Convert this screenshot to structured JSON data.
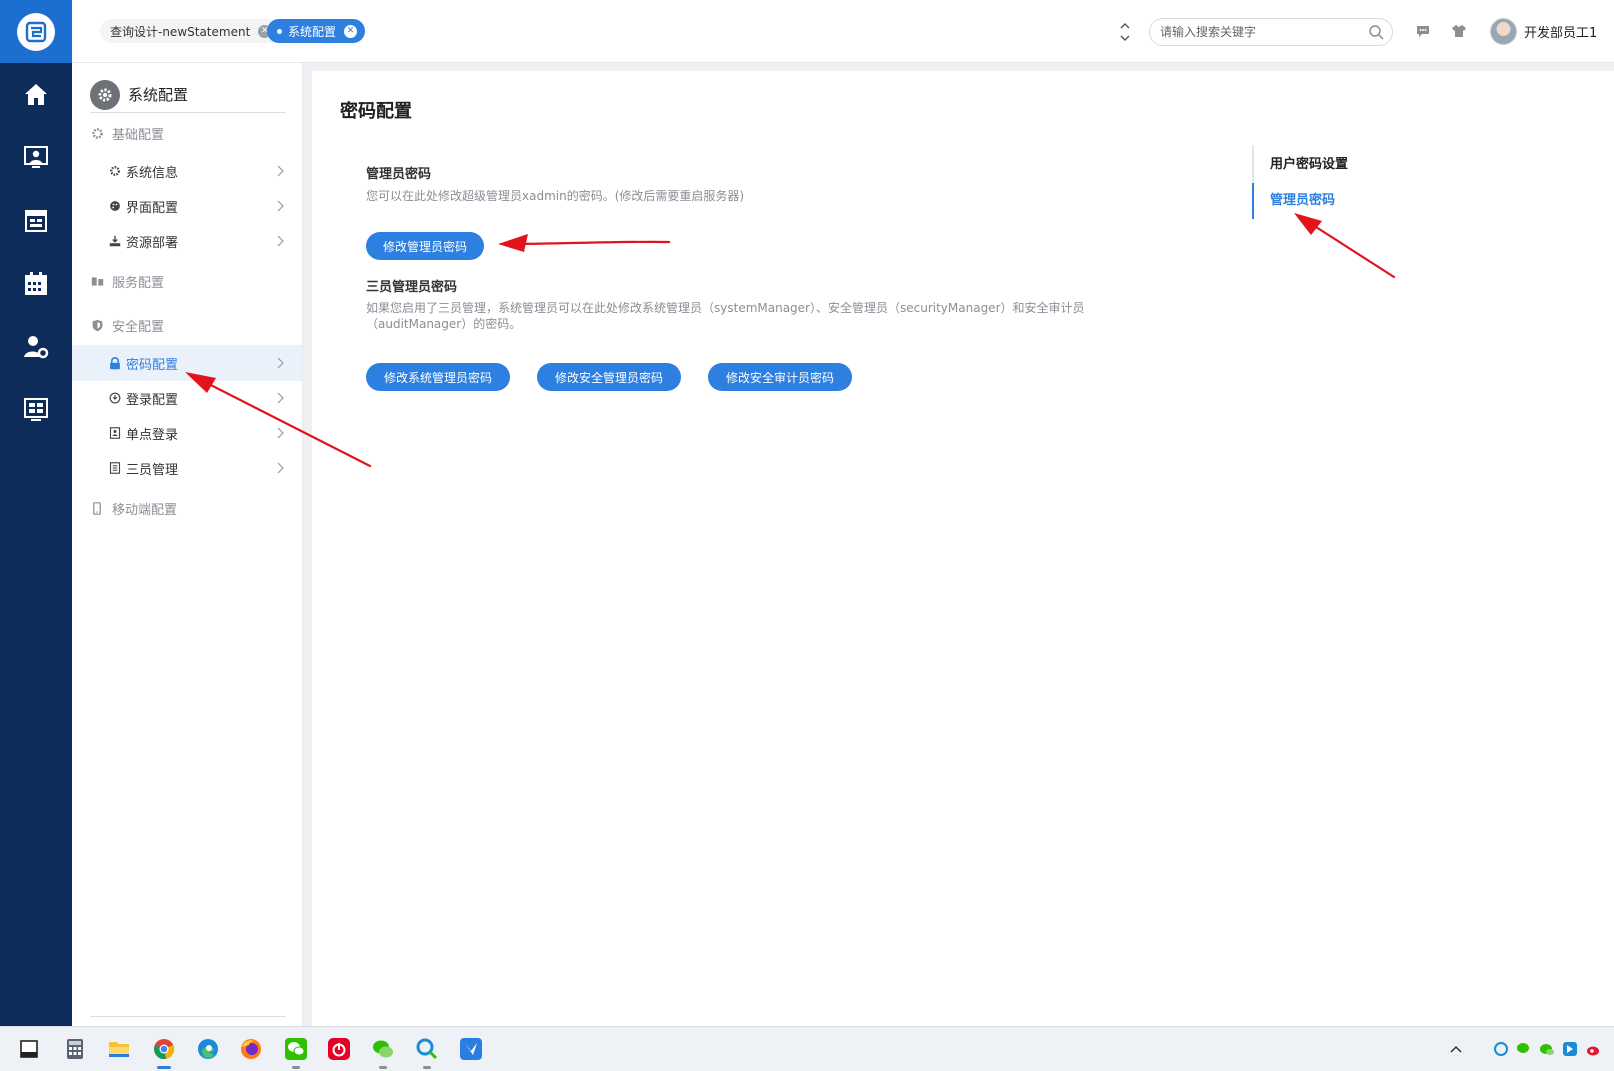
{
  "tabs": [
    {
      "label": "查询设计-newStatement",
      "active": false
    },
    {
      "label": "系统配置",
      "active": true
    }
  ],
  "search": {
    "placeholder": "请输入搜索关键字"
  },
  "user": {
    "name": "开发部员工1"
  },
  "sidebar": {
    "title": "系统配置",
    "groups": {
      "basic": "基础配置",
      "service": "服务配置",
      "security": "安全配置",
      "mobile": "移动端配置"
    },
    "items": {
      "sysinfo": "系统信息",
      "ui": "界面配置",
      "resource": "资源部署",
      "password": "密码配置",
      "login": "登录配置",
      "sso": "单点登录",
      "three": "三员管理"
    },
    "active_item": "密码配置"
  },
  "main": {
    "title": "密码配置",
    "admin": {
      "title": "管理员密码",
      "desc": "您可以在此处修改超级管理员xadmin的密码。(修改后需要重启服务器)",
      "button": "修改管理员密码"
    },
    "three": {
      "title": "三员管理员密码",
      "desc": "如果您启用了三员管理，系统管理员可以在此处修改系统管理员（systemManager）、安全管理员（securityManager）和安全审计员（auditManager）的密码。",
      "buttons": [
        "修改系统管理员密码",
        "修改安全管理员密码",
        "修改安全审计员密码"
      ]
    }
  },
  "anchor": {
    "items": [
      "用户密码设置",
      "管理员密码"
    ],
    "active": "管理员密码"
  },
  "colors": {
    "primary": "#2d7fe0",
    "rail": "#0e2c59",
    "annotation": "#e0141a"
  }
}
